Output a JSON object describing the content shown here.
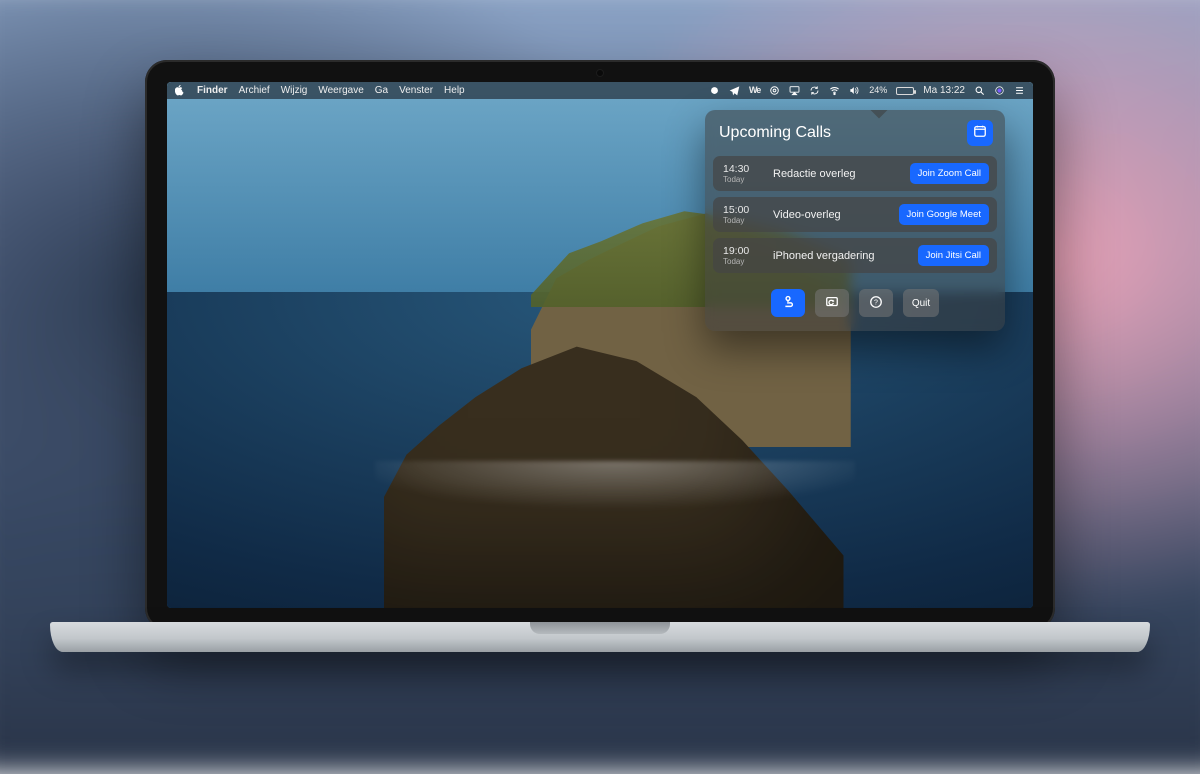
{
  "menubar": {
    "app": "Finder",
    "menus": [
      "Archief",
      "Wijzig",
      "Weergave",
      "Ga",
      "Venster",
      "Help"
    ],
    "battery_percent": "24%",
    "clock": "Ma 13:22"
  },
  "widget": {
    "title": "Upcoming Calls",
    "calls": [
      {
        "time": "14:30",
        "day": "Today",
        "title": "Redactie overleg",
        "action": "Join Zoom Call"
      },
      {
        "time": "15:00",
        "day": "Today",
        "title": "Video-overleg",
        "action": "Join Google Meet"
      },
      {
        "time": "19:00",
        "day": "Today",
        "title": "iPhoned vergadering",
        "action": "Join Jitsi Call"
      }
    ],
    "footer": {
      "quit": "Quit"
    }
  }
}
